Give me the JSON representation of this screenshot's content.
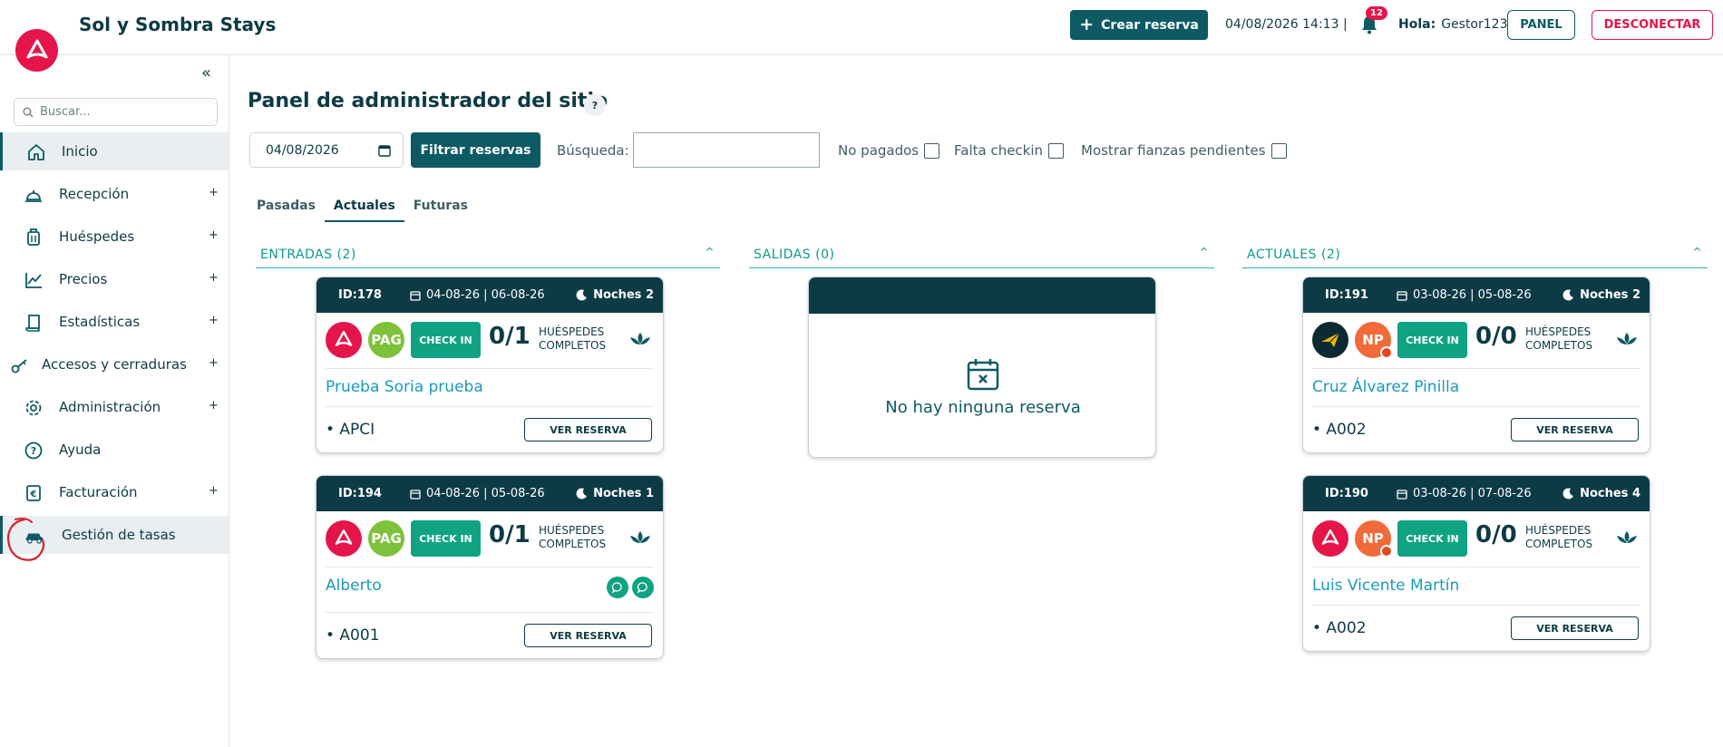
{
  "header": {
    "app_title": "Sol y Sombra Stays",
    "create_label": "Crear reserva",
    "datetime": "04/08/2026 14:13 |",
    "notification_count": "12",
    "greeting_label": "Hola:",
    "username": "Gestor123",
    "panel_label": "PANEL",
    "logout_label": "DESCONECTAR"
  },
  "sidebar": {
    "collapse_glyph": "«",
    "search_placeholder": "Buscar...",
    "items": [
      {
        "label": "Inicio",
        "icon": "home-icon",
        "expandable": false,
        "active": true
      },
      {
        "label": "Recepción",
        "icon": "reception-bell-icon",
        "expandable": true
      },
      {
        "label": "Huéspedes",
        "icon": "luggage-icon",
        "expandable": true
      },
      {
        "label": "Precios",
        "icon": "chart-line-icon",
        "expandable": true
      },
      {
        "label": "Estadísticas",
        "icon": "scroll-icon",
        "expandable": true
      },
      {
        "label": "Accesos y cerraduras",
        "icon": "key-icon",
        "expandable": true
      },
      {
        "label": "Administración",
        "icon": "gear-icon",
        "expandable": true
      },
      {
        "label": "Ayuda",
        "icon": "help-circle-icon",
        "expandable": false
      },
      {
        "label": "Facturación",
        "icon": "euro-icon",
        "expandable": true
      },
      {
        "label": "Gestión de tasas",
        "icon": "car-icon",
        "expandable": false,
        "highlighted": true
      }
    ],
    "plus_glyph": "+"
  },
  "main": {
    "title": "Panel de administrador del sitio",
    "help_glyph": "?",
    "date_value": "04/08/2026",
    "filter_label": "Filtrar reservas",
    "search_label": "Búsqueda:",
    "search_value": "",
    "checkboxes": [
      {
        "label": "No pagados",
        "checked": false
      },
      {
        "label": "Falta checkin",
        "checked": false
      },
      {
        "label": "Mostrar fianzas pendientes",
        "checked": false
      }
    ],
    "tabs": [
      {
        "label": "Pasadas",
        "active": false
      },
      {
        "label": "Actuales",
        "active": true
      },
      {
        "label": "Futuras",
        "active": false
      }
    ],
    "columns": [
      {
        "title": "ENTRADAS (2)"
      },
      {
        "title": "SALIDAS (0)",
        "empty_text": "No hay ninguna reserva"
      },
      {
        "title": "ACTUALES (2)"
      }
    ],
    "caret_glyph": "^",
    "cards": [
      {
        "id": "ID:178",
        "dates": "04-08-26 | 06-08-26",
        "nights": "Noches 2",
        "source": "logo",
        "status": "PAG",
        "checkin": "CHECK IN",
        "guests": "0/1",
        "guests_label_1": "HUÉSPEDES",
        "guests_label_2": "COMPLETOS",
        "name": "Prueba Soria prueba",
        "room": "• APCI",
        "view_label": "VER RESERVA"
      },
      {
        "id": "ID:194",
        "dates": "04-08-26 | 05-08-26",
        "nights": "Noches 1",
        "source": "logo",
        "status": "PAG",
        "checkin": "CHECK IN",
        "guests": "0/1",
        "guests_label_1": "HUÉSPEDES",
        "guests_label_2": "COMPLETOS",
        "name": "Alberto",
        "room": "• A001",
        "view_label": "VER RESERVA"
      },
      {
        "id": "ID:191",
        "dates": "03-08-26 | 05-08-26",
        "nights": "Noches 2",
        "source": "plane",
        "status": "NP",
        "checkin": "CHECK IN",
        "guests": "0/0",
        "guests_label_1": "HUÉSPEDES",
        "guests_label_2": "COMPLETOS",
        "name": "Cruz Álvarez Pinilla",
        "room": "• A002",
        "view_label": "VER RESERVA"
      },
      {
        "id": "ID:190",
        "dates": "03-08-26 | 07-08-26",
        "nights": "Noches 4",
        "source": "logo",
        "status": "NP",
        "checkin": "CHECK IN",
        "guests": "0/0",
        "guests_label_1": "HUÉSPEDES",
        "guests_label_2": "COMPLETOS",
        "name": "Luis Vicente Martín",
        "room": "• A002",
        "view_label": "VER RESERVA"
      }
    ]
  },
  "colors": {
    "brand_red": "#e5154a",
    "primary_teal": "#0d5a64",
    "dark_navy": "#0d3b45",
    "checkin_green": "#0fa383",
    "pag_green": "#7ec13a",
    "np_orange": "#f06a3a",
    "link_blue": "#1a9ab8"
  }
}
